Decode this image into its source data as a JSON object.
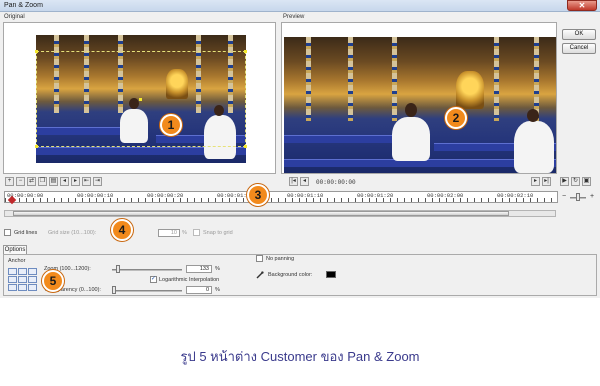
{
  "window": {
    "title": "Pan & Zoom",
    "close_glyph": "✕"
  },
  "panes": {
    "original_label": "Original",
    "preview_label": "Preview"
  },
  "buttons": {
    "ok": "OK",
    "cancel": "Cancel"
  },
  "timeline": {
    "preview_timecode": "00:00:00:00",
    "ruler_labels": [
      "00:00:00:00",
      "00:00:00:10",
      "00:00:00:20",
      "00:00:01:00",
      "00:00:01:10",
      "00:00:01:20",
      "00:00:02:00",
      "00:00:02:10"
    ]
  },
  "grid": {
    "grid_lines_label": "Grid lines",
    "grid_size_label": "Grid size (10...100):",
    "grid_size_value": "10",
    "grid_size_unit": "%",
    "snap_label": "Snap to grid"
  },
  "options": {
    "tab_label": "Options",
    "anchor_label": "Anchor",
    "zoom_label": "Zoom (100...1200):",
    "zoom_value": "133",
    "zoom_unit": "%",
    "log_interp_label": "Logarithmic Interpolation",
    "log_interp_checked": true,
    "transparency_label": "Transparency (0...100):",
    "transparency_value": "0",
    "transparency_unit": "%",
    "no_panning_label": "No panning",
    "bg_color_label": "Background color:",
    "bg_color": "#000000"
  },
  "callouts": [
    "1",
    "2",
    "3",
    "4",
    "5"
  ],
  "caption": "รูป 5 หน้าต่าง Customer ของ Pan & Zoom",
  "colors": {
    "callout": "#f28a1c",
    "caption": "#3a3a8c",
    "playhead": "#c0282b"
  }
}
